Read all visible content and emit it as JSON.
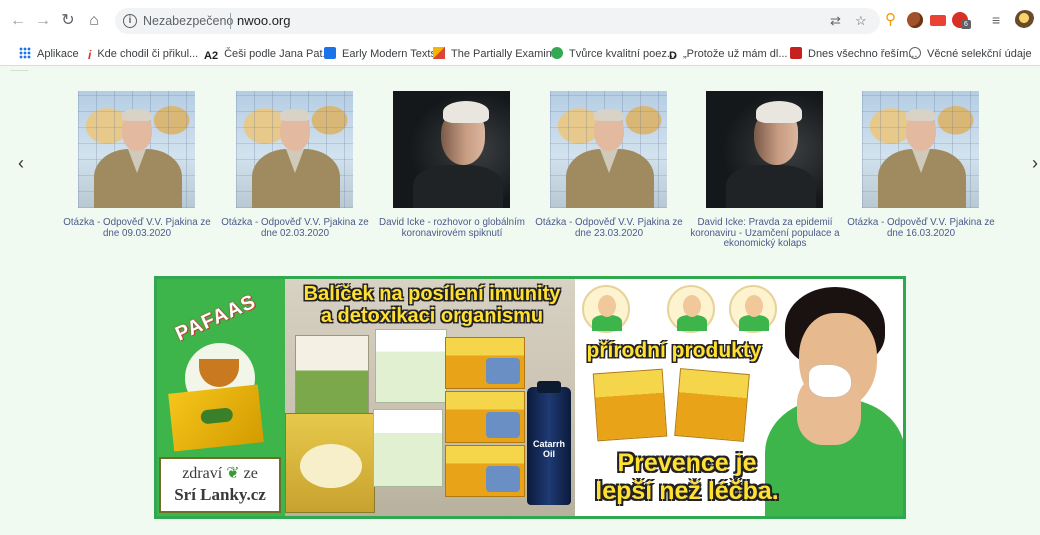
{
  "browser": {
    "security_label": "Nezabezpečeno",
    "url": "nwoo.org",
    "bookmarks": [
      {
        "label": "Aplikace",
        "icon": "apps-grid-icon"
      },
      {
        "label": "Kde chodil či přikul...",
        "icon": "italic-i-icon"
      },
      {
        "label": "Češi podle Jana Pat...",
        "prefix": "A2",
        "icon": "a2-icon"
      },
      {
        "label": "Early Modern Texts",
        "icon": "book-icon"
      },
      {
        "label": "The Partially Examin...",
        "icon": "picture-icon"
      },
      {
        "label": "Tvůrce kvalitní poez...",
        "icon": "green-dot-icon"
      },
      {
        "label": "„Protože už mám dl...",
        "icon": "d-logo-icon"
      },
      {
        "label": "Dnes všechno řeším...",
        "icon": "dn-icon"
      },
      {
        "label": "Věcné selekční údaje",
        "icon": "globe-icon"
      }
    ],
    "extension_badge": "6"
  },
  "carousel": {
    "prev_label": "‹",
    "next_label": "›",
    "items": [
      {
        "caption": "Otázka - Odpověď V.V. Pjakina ze dne 09.03.2020",
        "image": "pjakin"
      },
      {
        "caption": "Otázka - Odpověď V.V. Pjakina ze dne 02.03.2020",
        "image": "pjakin"
      },
      {
        "caption": "David Icke - rozhovor o globálním koronavirovém spiknutí",
        "image": "icke"
      },
      {
        "caption": "Otázka - Odpověď V.V. Pjakina ze dne 23.03.2020",
        "image": "pjakin"
      },
      {
        "caption": "David Icke: Pravda za epidemií koronaviru - Uzamčení populace a ekonomický kolaps",
        "image": "icke"
      },
      {
        "caption": "Otázka - Odpověď V.V. Pjakina ze dne 16.03.2020",
        "image": "pjakin"
      }
    ]
  },
  "banner": {
    "brand": "PAFAAS",
    "headline_1": "Balíček na posílení imunity",
    "headline_2": "a detoxikaci organismu",
    "natural": "přírodní produkty",
    "slogan_1": "Prevence je",
    "slogan_2": "lepší než léčba.",
    "logo_1a": "zdraví",
    "logo_leaf": "❦",
    "logo_1b": "ze",
    "logo_2": "Srí Lanky.cz",
    "bottle_1": "Catarrh",
    "bottle_2": "Oil",
    "accent_color": "#3db54a",
    "text_color": "#ffe033"
  }
}
